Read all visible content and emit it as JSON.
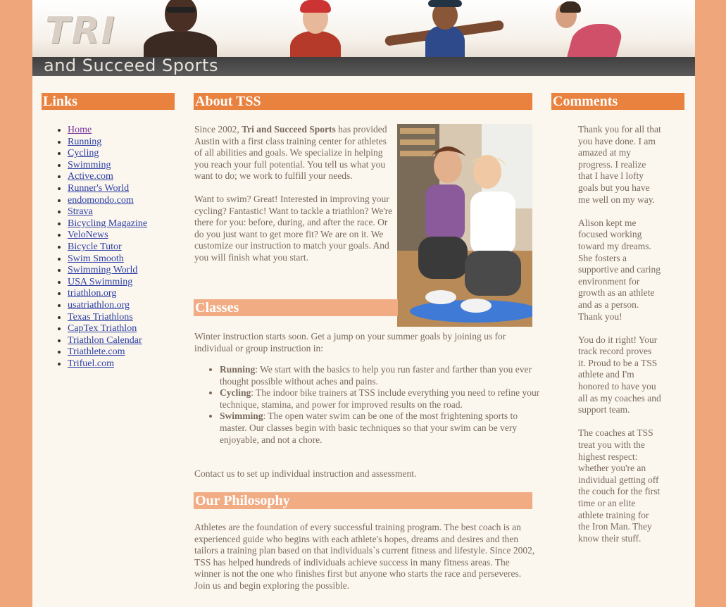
{
  "header": {
    "logo": "TRI",
    "tagline": "and Succeed Sports"
  },
  "links": {
    "heading": "Links",
    "items": [
      "Home",
      "Running",
      "Cycling",
      "Swimming",
      "Active.com",
      "Runner's World",
      "endomondo.com",
      "Strava",
      "Bicycling Magazine",
      "VeloNews",
      "Bicycle Tutor",
      "Swim Smooth",
      "Swimming World",
      "USA Swimming",
      "triathlon.org",
      "usatriathlon.org",
      "Texas Triathlons",
      "CapTex Triathlon",
      "Triathlon Calendar",
      "Triathlete.com",
      "Trifuel.com"
    ]
  },
  "about": {
    "heading": "About TSS",
    "p1_before": "Since 2002, ",
    "p1_strong": "Tri and Succeed Sports",
    "p1_after": " has provided Austin with a first class training center for athletes of all abilities and goals. We specialize in helping you reach your full potential. You tell us what you want to do; we work to fulfill your needs.",
    "p2": "Want to swim? Great! Interested in improving your cycling? Fantastic! Want to tackle a triathlon? We're there for you: before, during, and after the race. Or do you just want to get more fit? We are on it. We customize our instruction to match your goals. And you will finish what you start."
  },
  "classes": {
    "heading": "Classes",
    "intro": "Winter instruction starts soon. Get a jump on your summer goals by joining us for individual or group instruction in:",
    "items": [
      {
        "name": "Running",
        "text": ": We start with the basics to help you run faster and farther than you ever thought possible without aches and pains."
      },
      {
        "name": "Cycling",
        "text": ": The indoor bike trainers at TSS include everything you need to refine your technique, stamina, and power for improved results on the road."
      },
      {
        "name": "Swimming",
        "text": ": The open water swim can be one of the most frightening sports to master. Our classes begin with basic techniques so that your swim can be very enjoyable, and not a chore."
      }
    ],
    "contact": "Contact us to set up individual instruction and assessment."
  },
  "philosophy": {
    "heading": "Our Philosophy",
    "text": "Athletes are the foundation of every successful training program. The best coach is an experienced guide who begins with each athlete's hopes, dreams and desires and then tailors a training plan based on that individuals`s current fitness and lifestyle. Since 2002, TSS has helped hundreds of individuals achieve success in many fitness areas. The winner is not the one who finishes first but anyone who starts the race and perseveres. Join us and begin exploring the possible."
  },
  "comments": {
    "heading": "Comments",
    "items": [
      "Thank you for all that you have done. I am amazed at my progress. I realize that I have l lofty goals but you have me well on my way.",
      "Alison kept me focused working toward my dreams. She fosters a supportive and caring environment for growth as an athlete and as a person. Thank you!",
      "You do it right! Your track record proves it. Proud to be a TSS athlete and I'm honored to have you all as my coaches and support team.",
      "The coaches at TSS treat you with the highest respect: whether you're an individual getting off the couch for the first time or an elite athlete training for the Iron Man. They know their stuff."
    ]
  },
  "colors": {
    "page_bg": "#eea67a",
    "content_bg": "#fbf6ee",
    "heading_dark": "#e9823f",
    "heading_light": "#f1ac84",
    "tagline_bar": "#4a4a4a",
    "link": "#2b3fa6"
  }
}
